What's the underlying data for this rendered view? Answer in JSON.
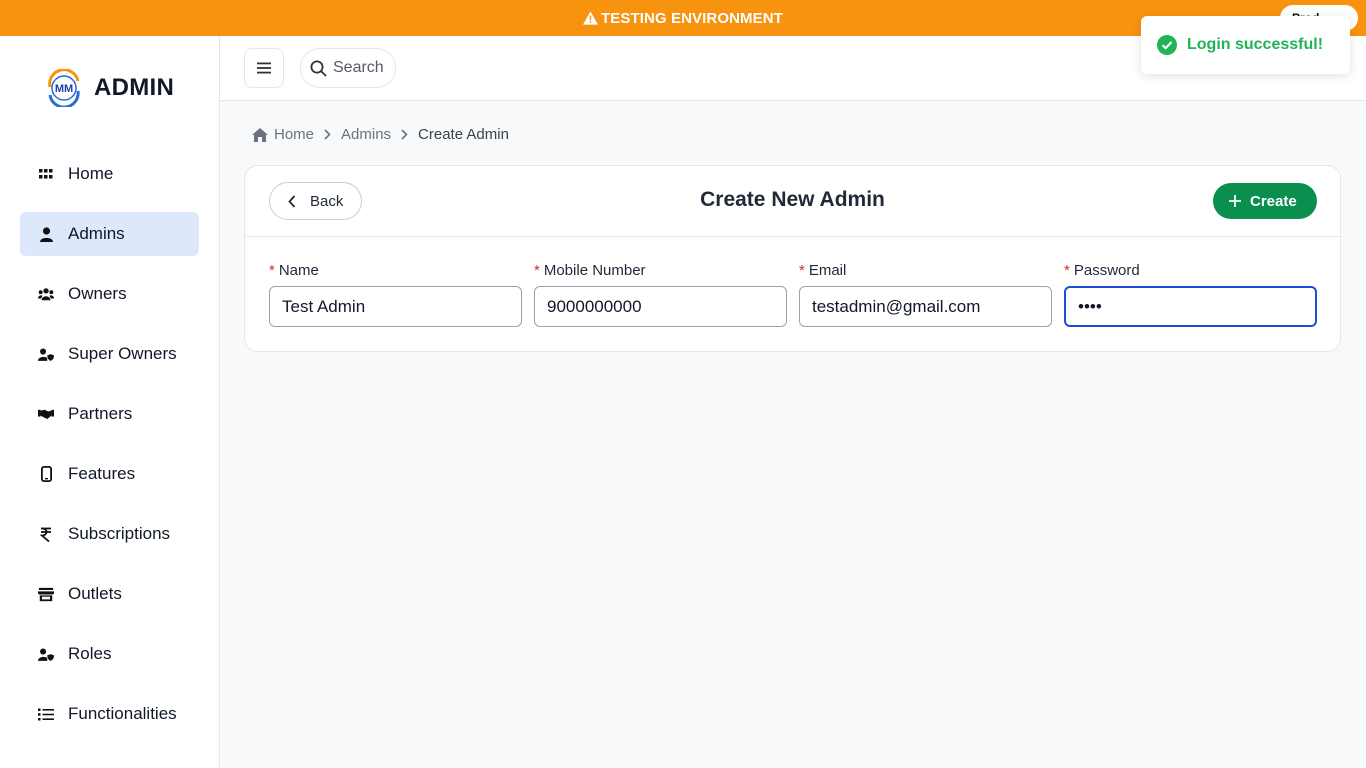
{
  "banner": {
    "text": "TESTING ENVIRONMENT",
    "prod_pill": "Prod"
  },
  "brand": {
    "name": "ADMIN",
    "logo_text": "MM"
  },
  "sidebar": {
    "items": [
      {
        "label": "Home",
        "icon": "grid-icon"
      },
      {
        "label": "Admins",
        "icon": "user-icon",
        "active": true
      },
      {
        "label": "Owners",
        "icon": "users-icon"
      },
      {
        "label": "Super Owners",
        "icon": "user-shield-icon"
      },
      {
        "label": "Partners",
        "icon": "handshake-icon"
      },
      {
        "label": "Features",
        "icon": "mobile-icon"
      },
      {
        "label": "Subscriptions",
        "icon": "rupee-icon"
      },
      {
        "label": "Outlets",
        "icon": "store-icon"
      },
      {
        "label": "Roles",
        "icon": "user-shield-icon"
      },
      {
        "label": "Functionalities",
        "icon": "list-icon"
      }
    ]
  },
  "header": {
    "search_label": "Search"
  },
  "toast": {
    "text": "Login successful!"
  },
  "breadcrumb": {
    "home": "Home",
    "admins": "Admins",
    "current": "Create Admin"
  },
  "card": {
    "title": "Create New Admin",
    "back_label": "Back",
    "create_label": "Create",
    "fields": [
      {
        "label": "Name",
        "value": "Test Admin"
      },
      {
        "label": "Mobile Number",
        "value": "9000000000"
      },
      {
        "label": "Email",
        "value": "testadmin@gmail.com"
      },
      {
        "label": "Password",
        "value": "••••"
      }
    ]
  },
  "colors": {
    "banner": "#f7930f",
    "accent_green": "#0b8f4f",
    "active_nav": "#dde8fb",
    "focus_blue": "#1d4ed8",
    "toast_green": "#22b357"
  }
}
